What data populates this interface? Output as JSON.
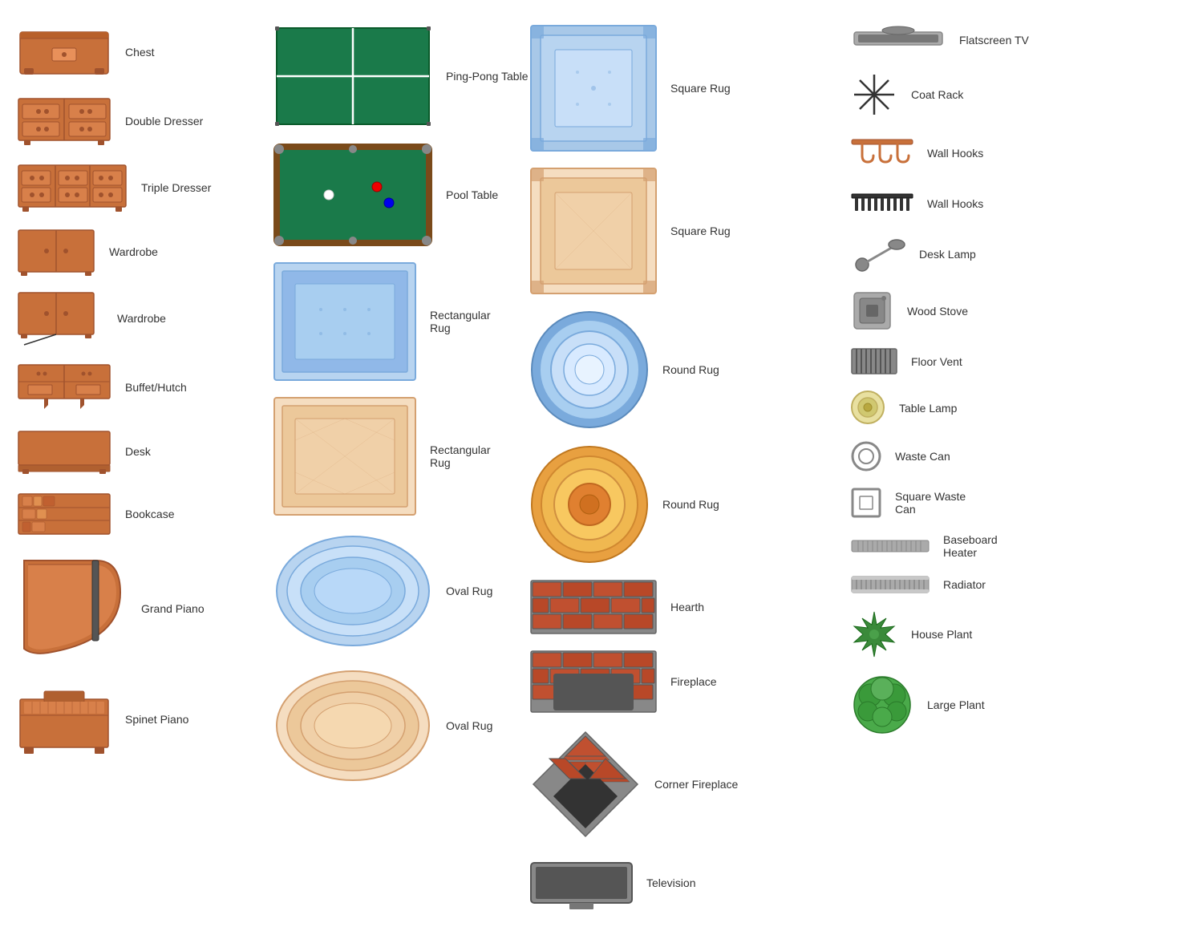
{
  "col1": {
    "items": [
      {
        "id": "chest",
        "label": "Chest"
      },
      {
        "id": "double-dresser",
        "label": "Double Dresser"
      },
      {
        "id": "triple-dresser",
        "label": "Triple Dresser"
      },
      {
        "id": "wardrobe1",
        "label": "Wardrobe"
      },
      {
        "id": "wardrobe2",
        "label": "Wardrobe"
      },
      {
        "id": "buffet-hutch",
        "label": "Buffet/Hutch"
      },
      {
        "id": "desk",
        "label": "Desk"
      },
      {
        "id": "bookcase",
        "label": "Bookcase"
      },
      {
        "id": "grand-piano",
        "label": "Grand Piano"
      },
      {
        "id": "spinet-piano",
        "label": "Spinet Piano"
      }
    ]
  },
  "col2": {
    "items": [
      {
        "id": "ping-pong",
        "label": "Ping-Pong Table"
      },
      {
        "id": "pool-table",
        "label": "Pool Table"
      },
      {
        "id": "rect-rug1",
        "label": "Rectangular\nRug"
      },
      {
        "id": "rect-rug2",
        "label": "Rectangular\nRug"
      },
      {
        "id": "oval-rug1",
        "label": "Oval Rug"
      },
      {
        "id": "oval-rug2",
        "label": "Oval Rug"
      }
    ]
  },
  "col3": {
    "items": [
      {
        "id": "square-rug1",
        "label": "Square Rug"
      },
      {
        "id": "square-rug2",
        "label": "Square Rug"
      },
      {
        "id": "round-rug1",
        "label": "Round Rug"
      },
      {
        "id": "round-rug2",
        "label": "Round Rug"
      },
      {
        "id": "hearth",
        "label": "Hearth"
      },
      {
        "id": "fireplace",
        "label": "Fireplace"
      },
      {
        "id": "corner-fireplace",
        "label": "Corner Fireplace"
      },
      {
        "id": "television",
        "label": "Television"
      }
    ]
  },
  "col4": {
    "items": [
      {
        "id": "flatscreen-tv",
        "label": "Flatscreen TV"
      },
      {
        "id": "coat-rack",
        "label": "Coat Rack"
      },
      {
        "id": "wall-hooks1",
        "label": "Wall Hooks"
      },
      {
        "id": "wall-hooks2",
        "label": "Wall Hooks"
      },
      {
        "id": "desk-lamp",
        "label": "Desk Lamp"
      },
      {
        "id": "wood-stove",
        "label": "Wood Stove"
      },
      {
        "id": "floor-vent",
        "label": "Floor Vent"
      },
      {
        "id": "table-lamp",
        "label": "Table Lamp"
      },
      {
        "id": "waste-can",
        "label": "Waste Can"
      },
      {
        "id": "square-waste-can",
        "label": "Square Waste\nCan"
      },
      {
        "id": "baseboard-heater",
        "label": "Baseboard\nHeater"
      },
      {
        "id": "radiator",
        "label": "Radiator"
      },
      {
        "id": "house-plant",
        "label": "House Plant"
      },
      {
        "id": "large-plant",
        "label": "Large Plant"
      }
    ]
  }
}
